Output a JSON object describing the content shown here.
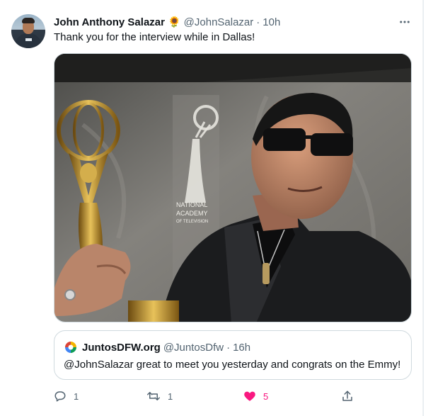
{
  "tweet": {
    "author_name": "John Anthony Salazar",
    "author_emoji": "🌻",
    "handle": "@JohnSalazar",
    "separator": "·",
    "time": "10h",
    "more_icon": "more-horizontal-icon",
    "text": "Thank you for the interview while in Dallas!",
    "media": {
      "description_icon": "photo",
      "sign_lines": [
        "NATIONAL",
        "ACADEMY",
        "OF TELEVISION"
      ]
    }
  },
  "quote": {
    "author_name": "JuntosDFW.org",
    "handle": "@JuntosDfw",
    "separator": "·",
    "time": "16h",
    "text": "@JohnSalazar great to meet you yesterday and congrats on the Emmy!"
  },
  "actions": {
    "reply": {
      "icon": "reply-icon",
      "count": "1"
    },
    "retweet": {
      "icon": "retweet-icon",
      "count": "1"
    },
    "like": {
      "icon": "heart-icon",
      "count": "5",
      "liked": true,
      "color": "#f91880"
    },
    "share": {
      "icon": "share-icon"
    }
  },
  "colors": {
    "text_primary": "#0f1419",
    "text_secondary": "#536471",
    "border": "#cfd9de",
    "like": "#f91880"
  }
}
